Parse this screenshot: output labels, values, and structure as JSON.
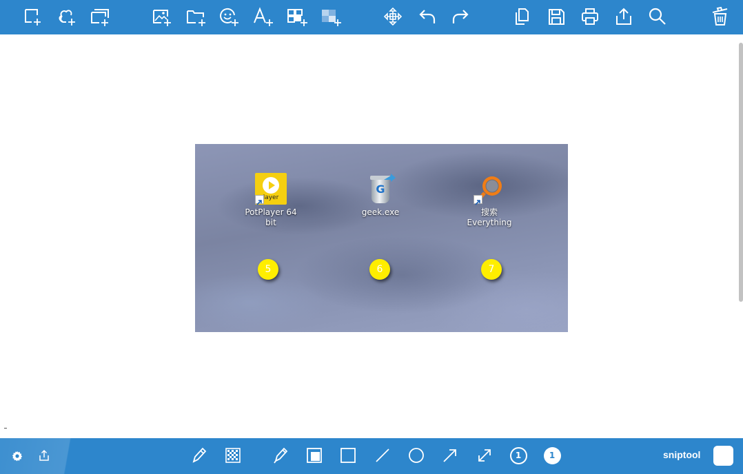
{
  "app": {
    "brand_label": "sniptool"
  },
  "colors": {
    "toolbar": "#2d86cc",
    "marker_fill": "#ffee00",
    "selected_color": "#ffffff"
  },
  "top_toolbar": {
    "items": [
      {
        "id": "rect-capture",
        "icon": "rectangle-add-icon"
      },
      {
        "id": "freeform-capture",
        "icon": "freeform-add-icon"
      },
      {
        "id": "window-capture",
        "icon": "window-add-icon"
      },
      {
        "id": "add-image",
        "icon": "image-add-icon"
      },
      {
        "id": "add-folder",
        "icon": "folder-add-icon"
      },
      {
        "id": "add-emoji",
        "icon": "emoji-add-icon"
      },
      {
        "id": "add-text",
        "icon": "text-add-icon"
      },
      {
        "id": "add-grid",
        "icon": "grid-add-icon"
      },
      {
        "id": "add-mosaic",
        "icon": "mosaic-add-icon"
      },
      {
        "id": "move",
        "icon": "move-icon"
      },
      {
        "id": "undo",
        "icon": "undo-icon"
      },
      {
        "id": "redo",
        "icon": "redo-icon"
      },
      {
        "id": "copy",
        "icon": "copy-icon"
      },
      {
        "id": "save",
        "icon": "save-icon"
      },
      {
        "id": "print",
        "icon": "print-icon"
      },
      {
        "id": "share",
        "icon": "share-icon"
      },
      {
        "id": "zoom",
        "icon": "search-icon"
      },
      {
        "id": "delete",
        "icon": "trash-icon"
      }
    ]
  },
  "bottom_toolbar": {
    "items": [
      {
        "id": "settings",
        "icon": "gear-icon"
      },
      {
        "id": "export",
        "icon": "share-icon"
      },
      {
        "id": "pencil",
        "icon": "pencil-icon"
      },
      {
        "id": "mosaic-brush",
        "icon": "mosaic-brush-icon"
      },
      {
        "id": "marker-pen",
        "icon": "marker-pen-icon"
      },
      {
        "id": "filled-rectangle",
        "icon": "filled-rectangle-icon"
      },
      {
        "id": "rectangle",
        "icon": "rectangle-icon"
      },
      {
        "id": "line",
        "icon": "line-icon"
      },
      {
        "id": "ellipse",
        "icon": "ellipse-icon"
      },
      {
        "id": "arrow",
        "icon": "arrow-icon"
      },
      {
        "id": "double-arrow",
        "icon": "double-arrow-icon"
      },
      {
        "id": "step-outline",
        "icon": "numbered-step-outline-icon",
        "label": "1"
      },
      {
        "id": "step-filled",
        "icon": "numbered-step-filled-icon",
        "label": "1"
      }
    ]
  },
  "screenshot": {
    "desktop_icons": [
      {
        "label": "PotPlayer 64 bit",
        "icon": "potplayer-icon",
        "icon_text": "layer",
        "shortcut": true
      },
      {
        "label": "geek.exe",
        "icon": "geek-uninstaller-icon",
        "icon_text": "G",
        "shortcut": false
      },
      {
        "label": "搜索 Everything",
        "icon": "everything-search-icon",
        "shortcut": true
      }
    ],
    "step_markers": [
      "5",
      "6",
      "7"
    ]
  }
}
